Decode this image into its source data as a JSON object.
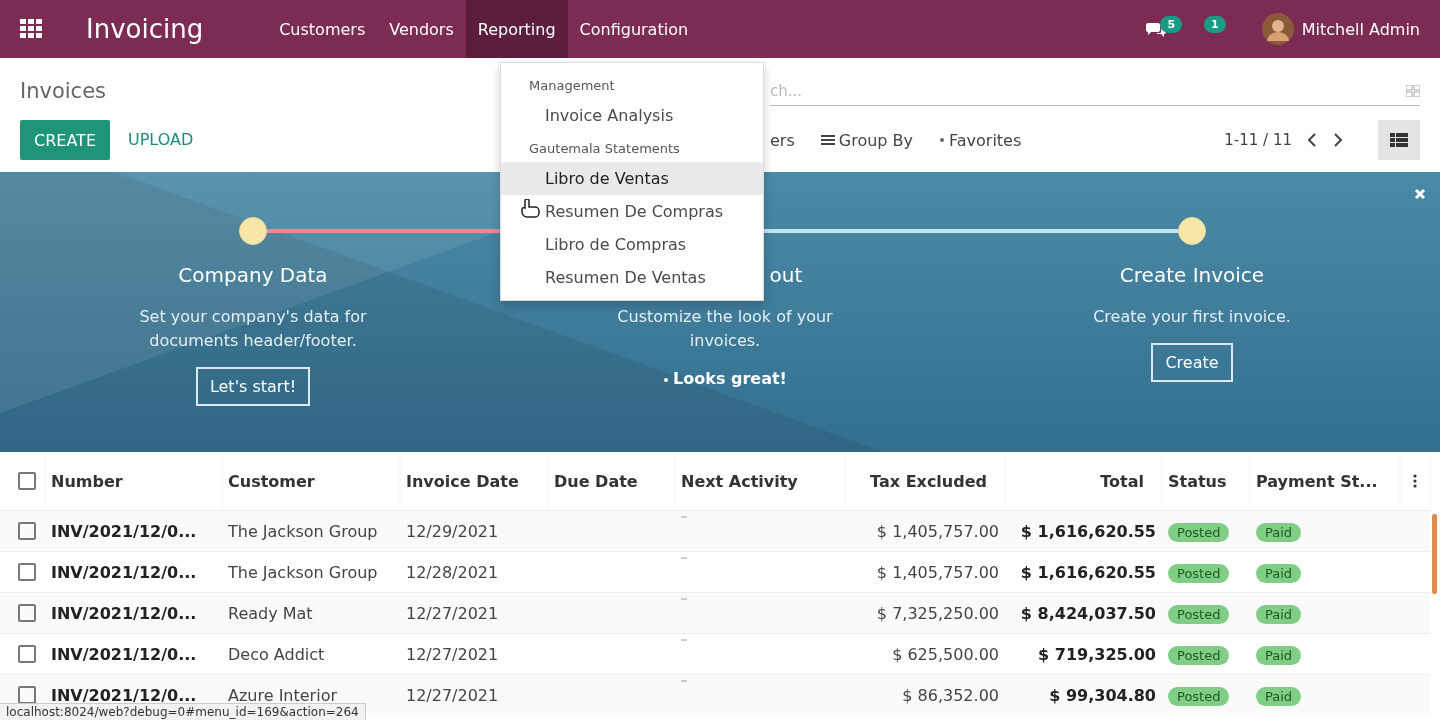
{
  "navbar": {
    "app_name": "Invoicing",
    "menus": [
      {
        "label": "Customers",
        "selected": false
      },
      {
        "label": "Vendors",
        "selected": false
      },
      {
        "label": "Reporting",
        "selected": true
      },
      {
        "label": "Configuration",
        "selected": false
      }
    ],
    "messages_count": "5",
    "activities_count": "1",
    "user_name": "Mitchell Admin"
  },
  "reporting_menu": {
    "sections": [
      {
        "header": "Management",
        "items": [
          {
            "label": "Invoice Analysis",
            "highlighted": false
          }
        ]
      },
      {
        "header": "Gautemala Statements",
        "items": [
          {
            "label": "Libro de Ventas",
            "highlighted": true
          },
          {
            "label": "Resumen De Compras",
            "highlighted": false
          },
          {
            "label": "Libro de Compras",
            "highlighted": false
          },
          {
            "label": "Resumen De Ventas",
            "highlighted": false
          }
        ]
      }
    ]
  },
  "control_panel": {
    "title": "Invoices",
    "create_button": "CREATE",
    "upload_button": "UPLOAD",
    "search": {
      "placeholder": "ch..."
    },
    "filters_label": "ers",
    "group_by_label": "Group By",
    "favorites_label": "Favorites",
    "pager": "1-11 / 11"
  },
  "onboarding": {
    "steps": [
      {
        "title": "Company Data",
        "description": "Set your company's data for documents header/footer.",
        "kind": "button",
        "action": "Let's start!"
      },
      {
        "title": "out",
        "description": "Customize the look of your invoices.",
        "kind": "done",
        "action": "Looks great!"
      },
      {
        "title": "Create Invoice",
        "description": "Create your first invoice.",
        "kind": "button",
        "action": "Create"
      }
    ]
  },
  "table": {
    "select_all_checked": false,
    "columns": [
      "Number",
      "Customer",
      "Invoice Date",
      "Due Date",
      "Next Activity",
      "Tax Excluded",
      "Total",
      "Status",
      "Payment St..."
    ],
    "rows": [
      {
        "checked": false,
        "number": "INV/2021/12/0...",
        "customer": "The Jackson Group",
        "invoice_date": "12/29/2021",
        "tax_excluded": "$ 1,405,757.00",
        "total": "$ 1,616,620.55",
        "status": "Posted",
        "payment_status": "Paid"
      },
      {
        "checked": false,
        "number": "INV/2021/12/0...",
        "customer": "The Jackson Group",
        "invoice_date": "12/28/2021",
        "tax_excluded": "$ 1,405,757.00",
        "total": "$ 1,616,620.55",
        "status": "Posted",
        "payment_status": "Paid"
      },
      {
        "checked": false,
        "number": "INV/2021/12/0...",
        "customer": "Ready Mat",
        "invoice_date": "12/27/2021",
        "tax_excluded": "$ 7,325,250.00",
        "total": "$ 8,424,037.50",
        "status": "Posted",
        "payment_status": "Paid"
      },
      {
        "checked": false,
        "number": "INV/2021/12/0...",
        "customer": "Deco Addict",
        "invoice_date": "12/27/2021",
        "tax_excluded": "$ 625,500.00",
        "total": "$ 719,325.00",
        "status": "Posted",
        "payment_status": "Paid"
      },
      {
        "checked": false,
        "number": "INV/2021/12/0...",
        "customer": "Azure Interior",
        "invoice_date": "12/27/2021",
        "tax_excluded": "$ 86,352.00",
        "total": "$ 99,304.80",
        "status": "Posted",
        "payment_status": "Paid"
      }
    ]
  },
  "status_url": "localhost:8024/web?debug=0#menu_id=169&action=264"
}
